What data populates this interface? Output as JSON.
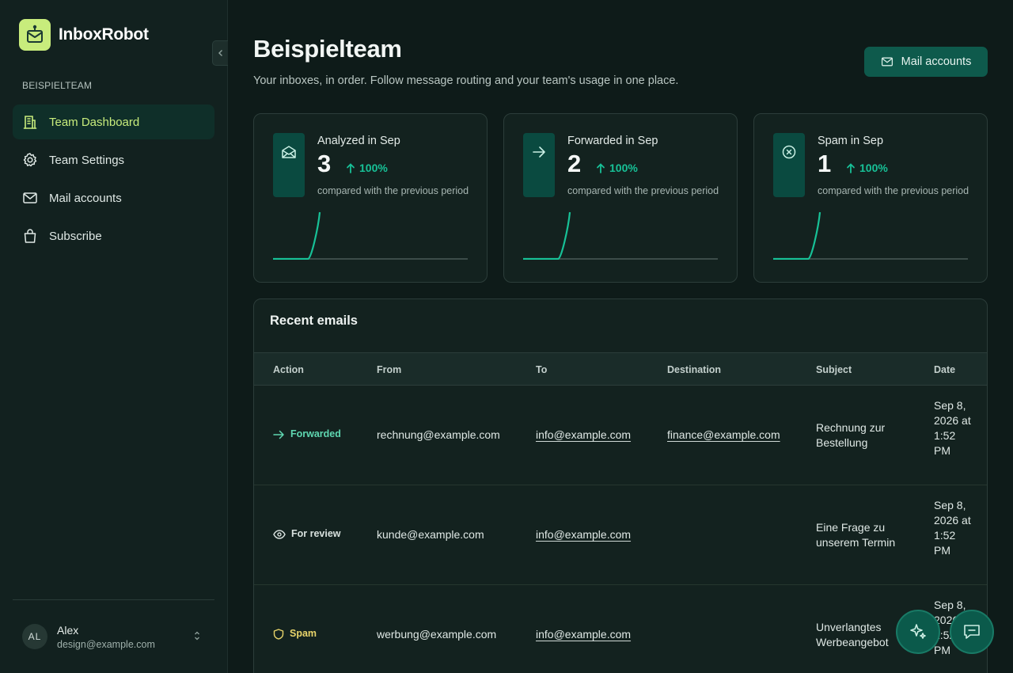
{
  "app": {
    "name": "InboxRobot"
  },
  "sidebar": {
    "team_label": "BEISPIELTEAM",
    "items": [
      {
        "label": "Team Dashboard",
        "icon": "building-icon",
        "active": true
      },
      {
        "label": "Team Settings",
        "icon": "gear-icon",
        "active": false
      },
      {
        "label": "Mail accounts",
        "icon": "mail-icon",
        "active": false
      },
      {
        "label": "Subscribe",
        "icon": "bag-icon",
        "active": false
      }
    ],
    "user": {
      "initials": "AL",
      "name": "Alex",
      "email": "design@example.com"
    }
  },
  "header": {
    "title": "Beispielteam",
    "subtitle": "Your inboxes, in order. Follow message routing and your team's usage in one place.",
    "mail_button": "Mail accounts"
  },
  "stats": [
    {
      "label": "Analyzed in Sep",
      "value": "3",
      "change": "100%",
      "compare": "compared with the previous period",
      "icon": "open-envelope-icon",
      "spark": [
        0,
        0,
        0,
        0,
        1
      ]
    },
    {
      "label": "Forwarded in Sep",
      "value": "2",
      "change": "100%",
      "compare": "compared with the previous period",
      "icon": "arrow-right-icon",
      "spark": [
        0,
        0,
        0,
        0,
        1
      ]
    },
    {
      "label": "Spam in Sep",
      "value": "1",
      "change": "100%",
      "compare": "compared with the previous period",
      "icon": "x-circle-icon",
      "spark": [
        0,
        0,
        0,
        0,
        1
      ]
    }
  ],
  "recent": {
    "title": "Recent emails",
    "columns": [
      "Action",
      "From",
      "To",
      "Destination",
      "Subject",
      "Date"
    ],
    "rows": [
      {
        "action": "Forwarded",
        "action_type": "forwarded",
        "from": "rechnung@example.com",
        "to": "info@example.com",
        "destination": "finance@example.com",
        "subject": "Rechnung zur Bestellung",
        "date": "Sep 8, 2026 at 1:52 PM"
      },
      {
        "action": "For review",
        "action_type": "review",
        "from": "kunde@example.com",
        "to": "info@example.com",
        "destination": "",
        "subject": "Eine Frage zu unserem Termin",
        "date": "Sep 8, 2026 at 1:52 PM"
      },
      {
        "action": "Spam",
        "action_type": "spam",
        "from": "werbung@example.com",
        "to": "info@example.com",
        "destination": "",
        "subject": "Unverlangtes Werbeangebot",
        "date": "Sep 8, 2026 at 1:52 PM"
      }
    ]
  },
  "colors": {
    "accent": "#c8ec7c",
    "teal": "#17c197",
    "button": "#0e5a4c"
  }
}
